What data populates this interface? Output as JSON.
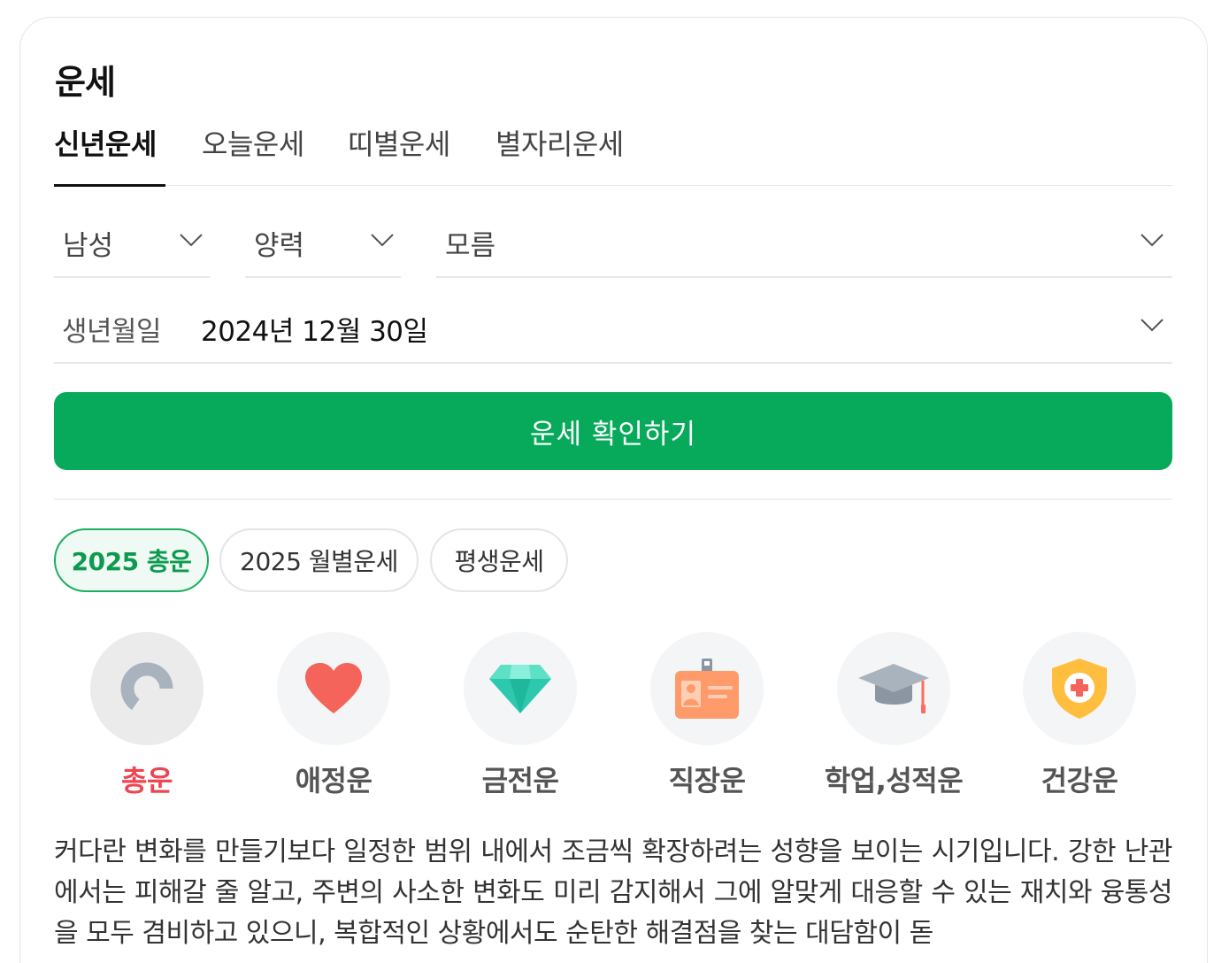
{
  "section_title": "운세",
  "tabs": [
    {
      "label": "신년운세",
      "active": true
    },
    {
      "label": "오늘운세",
      "active": false
    },
    {
      "label": "띠별운세",
      "active": false
    },
    {
      "label": "별자리운세",
      "active": false
    }
  ],
  "form": {
    "gender": "남성",
    "calendar": "양력",
    "birth_time": "모름",
    "dob_label": "생년월일",
    "dob_value": "2024년 12월 30일"
  },
  "cta_label": "운세 확인하기",
  "chips": [
    {
      "label": "2025 총운",
      "active": true
    },
    {
      "label": "2025 월별운세",
      "active": false
    },
    {
      "label": "평생운세",
      "active": false
    }
  ],
  "categories": [
    {
      "label": "총운",
      "icon": "donut-chart-icon",
      "active": true
    },
    {
      "label": "애정운",
      "icon": "heart-icon",
      "active": false
    },
    {
      "label": "금전운",
      "icon": "diamond-icon",
      "active": false
    },
    {
      "label": "직장운",
      "icon": "id-badge-icon",
      "active": false
    },
    {
      "label": "학업,성적운",
      "icon": "graduation-cap-icon",
      "active": false
    },
    {
      "label": "건강운",
      "icon": "health-shield-icon",
      "active": false
    }
  ],
  "description": "커다란 변화를 만들기보다 일정한 범위 내에서 조금씩 확장하려는 성향을 보이는 시기입니다. 강한 난관에서는 피해갈 줄 알고, 주변의 사소한 변화도 미리 감지해서 그에 알맞게 대응할 수 있는 재치와 융통성을 모두 겸비하고 있으니, 복합적인 상황에서도 순탄한 해결점을 찾는 대담함이 돋",
  "colors": {
    "primary_green": "#07aa5a",
    "active_category_red": "#ef4550"
  }
}
